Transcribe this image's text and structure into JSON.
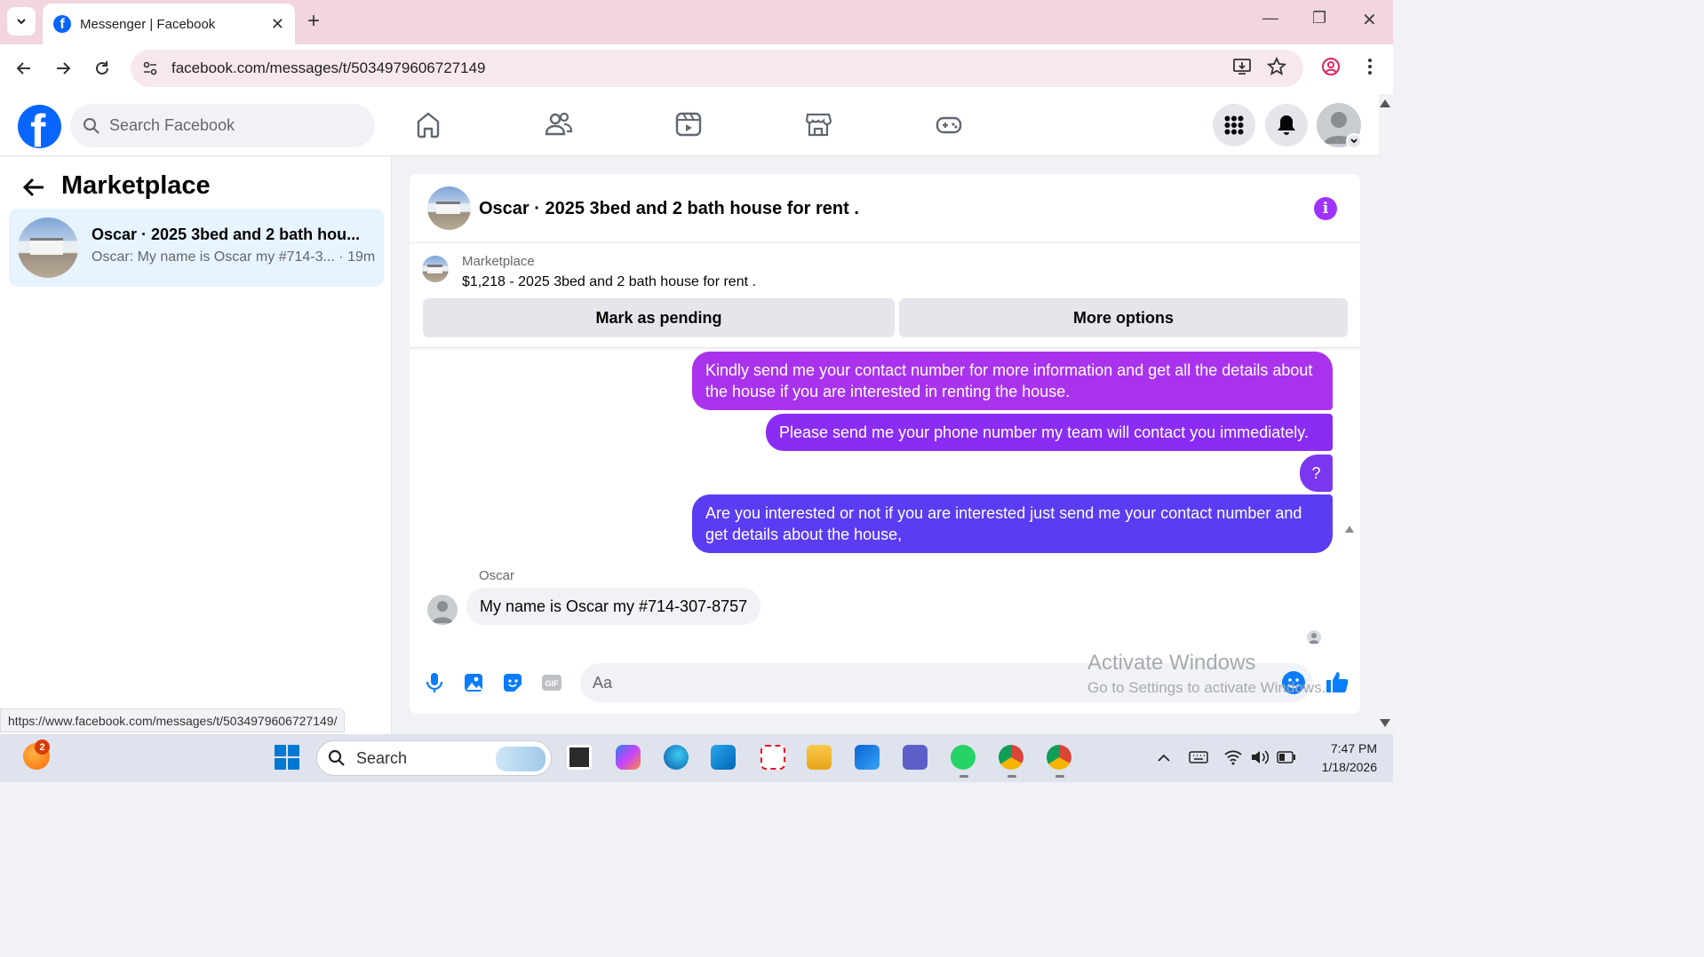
{
  "browser": {
    "tab_title": "Messenger | Facebook",
    "address": "facebook.com/messages/t/5034979606727149",
    "status_url": "https://www.facebook.com/messages/t/5034979606727149/"
  },
  "fb_header": {
    "logo_letter": "f",
    "search_placeholder": "Search Facebook"
  },
  "sidebar": {
    "title": "Marketplace",
    "conversation": {
      "title": "Oscar · 2025 3bed and 2 bath hou...",
      "preview": "Oscar: My name is Oscar my #714-3... · 19m"
    }
  },
  "chat": {
    "title": "Oscar · 2025 3bed and 2 bath house for rent .",
    "info_glyph": "i",
    "listing": {
      "label": "Marketplace",
      "detail": "$1,218 - 2025 3bed and 2 bath house for rent ."
    },
    "buttons": {
      "pending": "Mark as pending",
      "more": "More options"
    },
    "messages": [
      {
        "from": "me",
        "text": "Kindly send me your contact number for more information and get all the details about the house if you are interested in renting the house."
      },
      {
        "from": "me",
        "text": "Please send me your phone number my team will contact you immediately."
      },
      {
        "from": "me",
        "text": "?"
      },
      {
        "from": "me",
        "text": "Are you interested or not if you are interested just send me your contact number and get details about the house,"
      },
      {
        "from": "Oscar",
        "text": "My name is Oscar my #714-307-8757"
      }
    ],
    "sender_name": "Oscar",
    "composer_placeholder": "Aa"
  },
  "watermark": {
    "line1": "Activate Windows",
    "line2": "Go to Settings to activate Windows."
  },
  "taskbar": {
    "weather_badge": "2",
    "search_label": "Search",
    "time": "7:47 PM",
    "date": "1/18/2026"
  },
  "colors": {
    "fb_blue": "#0866ff",
    "bubble_1": "#a933ed",
    "bubble_2": "#8a2cf3",
    "bubble_3": "#7b37f0",
    "bubble_4": "#5b3cf2",
    "info": "#a033ff"
  },
  "icons": [
    "chevron-down-icon",
    "close-icon",
    "plus-icon",
    "minimize-icon",
    "restore-icon",
    "back-icon",
    "forward-icon",
    "reload-icon",
    "site-settings-icon",
    "install-icon",
    "star-icon",
    "profile-icon",
    "more-vert-icon",
    "home-icon",
    "friends-icon",
    "video-icon",
    "marketplace-icon",
    "gaming-icon",
    "menu-grid-icon",
    "bell-icon",
    "arrow-left-icon",
    "info-icon",
    "mic-icon",
    "image-icon",
    "sticker-icon",
    "gif-icon",
    "emoji-icon",
    "thumbs-up-icon",
    "windows-start-icon",
    "search-icon"
  ]
}
